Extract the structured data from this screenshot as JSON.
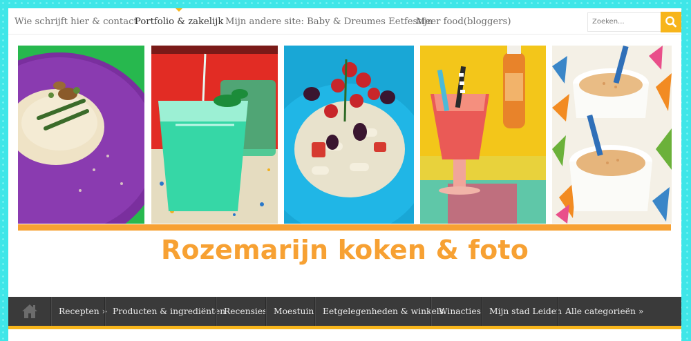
{
  "top_nav": {
    "items": [
      "Wie schrijft hier & contact",
      "Portfolio & zakelijk",
      "Mijn andere site: Baby & Dreumes Eetfestijn",
      "Meer food(bloggers)"
    ],
    "active_index": 1
  },
  "search": {
    "placeholder": "Zoeken..."
  },
  "header": {
    "title": "Rozemarijn koken & foto"
  },
  "photos": [
    "risotto-with-asparagus",
    "green-drink-with-mint",
    "pasta-salad-with-tomatoes-olives",
    "red-smoothie-with-straws",
    "hummus-cups-with-spoons"
  ],
  "main_nav": {
    "home_icon": "home-icon",
    "items": [
      "Recepten »",
      "Producten & ingrediënten",
      "Recensies",
      "Moestuin",
      "Eetgelegenheden & winkels",
      "Winacties",
      "Mijn stad Leiden",
      "Alle categorieën »"
    ]
  },
  "colors": {
    "accent": "#f7b51b",
    "title": "#f7a133",
    "nav_bg": "#3a3a3a",
    "page_bg": "#3fe6e8"
  }
}
